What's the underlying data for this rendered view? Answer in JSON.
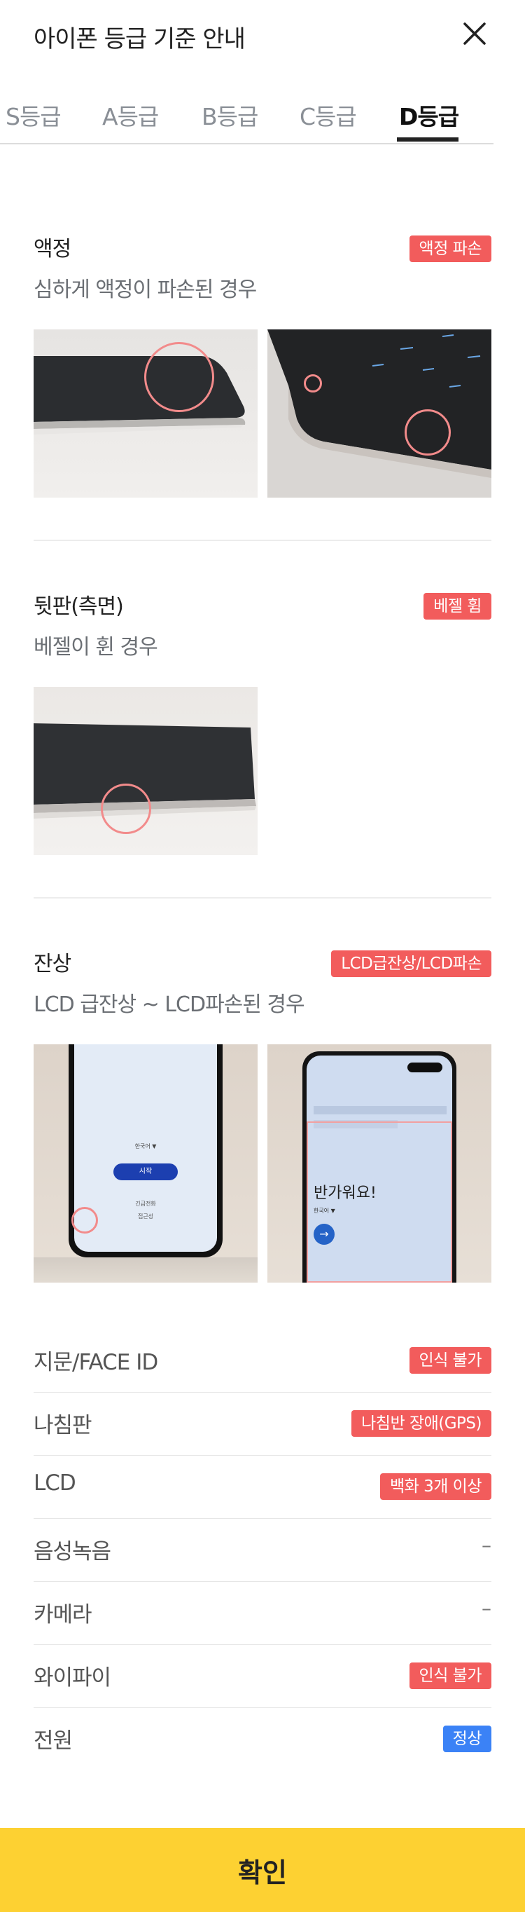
{
  "header": {
    "title": "아이폰 등급 기준 안내"
  },
  "tabs": [
    "S등급",
    "A등급",
    "B등급",
    "C등급",
    "D등급"
  ],
  "sections": [
    {
      "label": "액정",
      "description": "심하게 액정이 파손된 경우",
      "badge": "액정 파손"
    },
    {
      "label": "뒷판(측면)",
      "description": "베젤이 휜 경우",
      "badge": "베젤 휨"
    },
    {
      "label": "잔상",
      "description": "LCD 급잔상 ~ LCD파손된 경우",
      "badge": "LCD급잔상/LCD파손"
    }
  ],
  "phone_screen_a": {
    "lang": "한국어 ▼",
    "start": "시작",
    "emergency": "긴급전화",
    "access": "접근성"
  },
  "phone_screen_b": {
    "greeting": "반가워요!",
    "lang": "한국어 ▼"
  },
  "specs": [
    {
      "key": "지문/FACE ID",
      "value": "인식 불가",
      "type": "red"
    },
    {
      "key": "나침판",
      "value": "나침반 장애(GPS)",
      "type": "red"
    },
    {
      "key": "LCD",
      "value": "백화 3개 이상",
      "type": "red"
    },
    {
      "key": "음성녹음",
      "value": "–",
      "type": "dash"
    },
    {
      "key": "카메라",
      "value": "–",
      "type": "dash"
    },
    {
      "key": "와이파이",
      "value": "인식 불가",
      "type": "red"
    },
    {
      "key": "전원",
      "value": "정상",
      "type": "blue"
    }
  ],
  "confirm_label": "확인",
  "colors": {
    "badge_red": "#f25c5c",
    "badge_blue": "#3b82f6",
    "confirm": "#fdd132"
  }
}
